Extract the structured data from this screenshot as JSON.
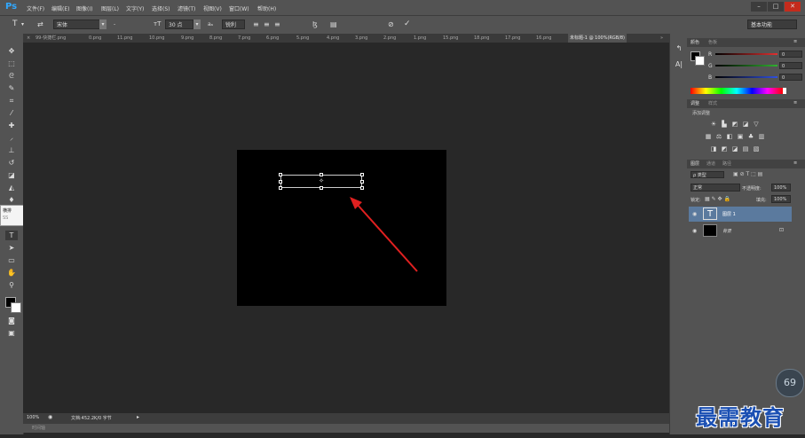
{
  "app": {
    "logo": "Ps"
  },
  "menu": [
    "文件(F)",
    "编辑(E)",
    "图像(I)",
    "图层(L)",
    "文字(Y)",
    "选择(S)",
    "滤镜(T)",
    "视图(V)",
    "窗口(W)",
    "帮助(H)"
  ],
  "window_controls": {
    "minimize": "–",
    "maximize": "□",
    "close": "✕"
  },
  "options": {
    "font_family": "宋体",
    "font_style": "-",
    "font_size": "30 点",
    "aa_label": "aₐ",
    "antialias": "锐利",
    "color_swatch": "#d40000",
    "workspace": "基本功能"
  },
  "tabs": [
    "99-快捷栏.png",
    "0.png",
    "11.png",
    "10.png",
    "9.png",
    "8.png",
    "7.png",
    "6.png",
    "5.png",
    "4.png",
    "3.png",
    "2.png",
    "1.png",
    "15.png",
    "18.png",
    "17.png",
    "16.png",
    "未标题-1 @ 100%(RGB/8)"
  ],
  "tab_overflow": "»",
  "tooltip": {
    "line1": "横排",
    "line2": "SS"
  },
  "status": {
    "zoom": "100%",
    "doc": "文档:452.2K/0 字节"
  },
  "bottom_strip_label": "时间轴",
  "panels": {
    "color": {
      "tabs": [
        "颜色",
        "色板"
      ],
      "channels": [
        {
          "label": "R",
          "value": "0",
          "color": "#e03030"
        },
        {
          "label": "G",
          "value": "0",
          "color": "#30b030"
        },
        {
          "label": "B",
          "value": "0",
          "color": "#3050e0"
        }
      ]
    },
    "adjustments": {
      "tabs": [
        "调整",
        "样式"
      ],
      "add_label": "添加调整"
    },
    "layers": {
      "tabs": [
        "图层",
        "通道",
        "路径"
      ],
      "kind_filter": "ρ 类型",
      "blend_mode": "正常",
      "opacity_label": "不透明度:",
      "opacity_value": "100%",
      "lock_label": "锁定:",
      "fill_label": "填充:",
      "fill_value": "100%",
      "items": [
        {
          "name": "图层 1",
          "thumb": "T"
        },
        {
          "name": "背景",
          "thumb": ""
        }
      ]
    }
  },
  "badge": "69",
  "watermark": "最需教育"
}
